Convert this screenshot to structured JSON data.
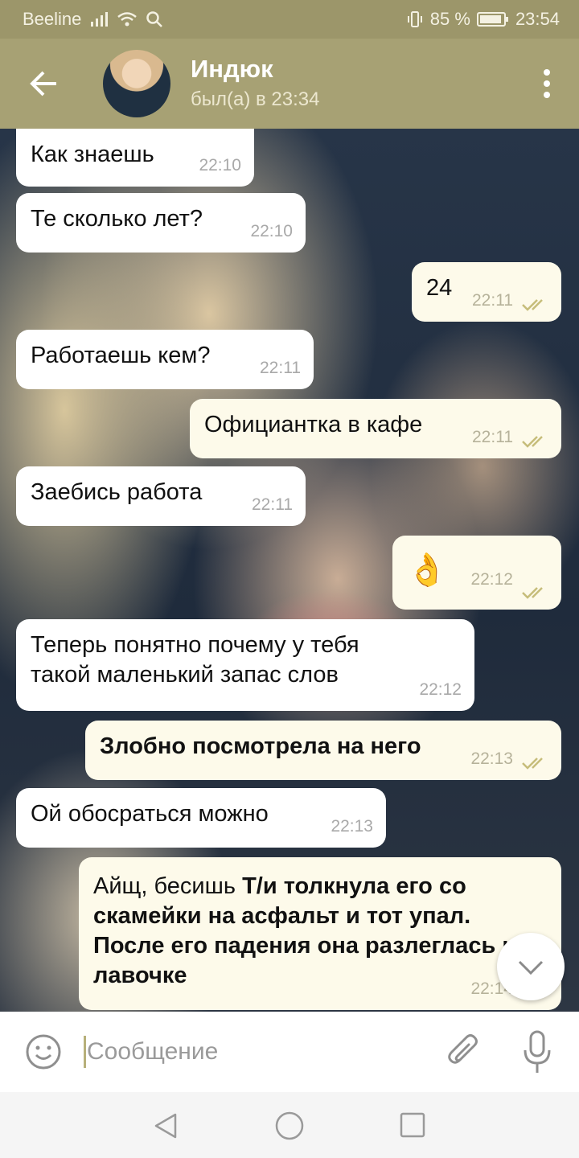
{
  "status_bar": {
    "carrier": "Beeline",
    "battery": "85 %",
    "time": "23:54"
  },
  "header": {
    "title": "Индюк",
    "subtitle": "был(а) в 23:34"
  },
  "messages": [
    {
      "text": "Как знаешь",
      "time": "22:10",
      "direction": "in"
    },
    {
      "text": "Те сколько лет?",
      "time": "22:10",
      "direction": "in"
    },
    {
      "text": "24",
      "time": "22:11",
      "direction": "out",
      "read": true
    },
    {
      "text": "Работаешь кем?",
      "time": "22:11",
      "direction": "in"
    },
    {
      "text": "Официантка в кафе",
      "time": "22:11",
      "direction": "out",
      "read": true
    },
    {
      "text": "Заебись работа",
      "time": "22:11",
      "direction": "in"
    },
    {
      "text": "👌",
      "time": "22:12",
      "direction": "out",
      "read": true
    },
    {
      "text": "Теперь понятно почему у тебя такой маленький запас слов",
      "time": "22:12",
      "direction": "in"
    },
    {
      "text": "Злобно посмотрела на него",
      "time": "22:13",
      "direction": "out",
      "read": true
    },
    {
      "text": "Ой обосраться можно",
      "time": "22:13",
      "direction": "in"
    },
    {
      "text": "Айщ, бесишь",
      "bold_text": "Т/и толкнула его со скамейки на асфальт и тот упал. После его падения она разлеглась на лавочке",
      "time": "22:14",
      "direction": "out",
      "read": true
    }
  ],
  "input": {
    "placeholder": "Сообщение"
  },
  "colors": {
    "header": "#a7a174",
    "status_bar": "#9c966a",
    "outgoing_bubble": "#fdfaea",
    "check_mark": "#c6bd7a"
  }
}
